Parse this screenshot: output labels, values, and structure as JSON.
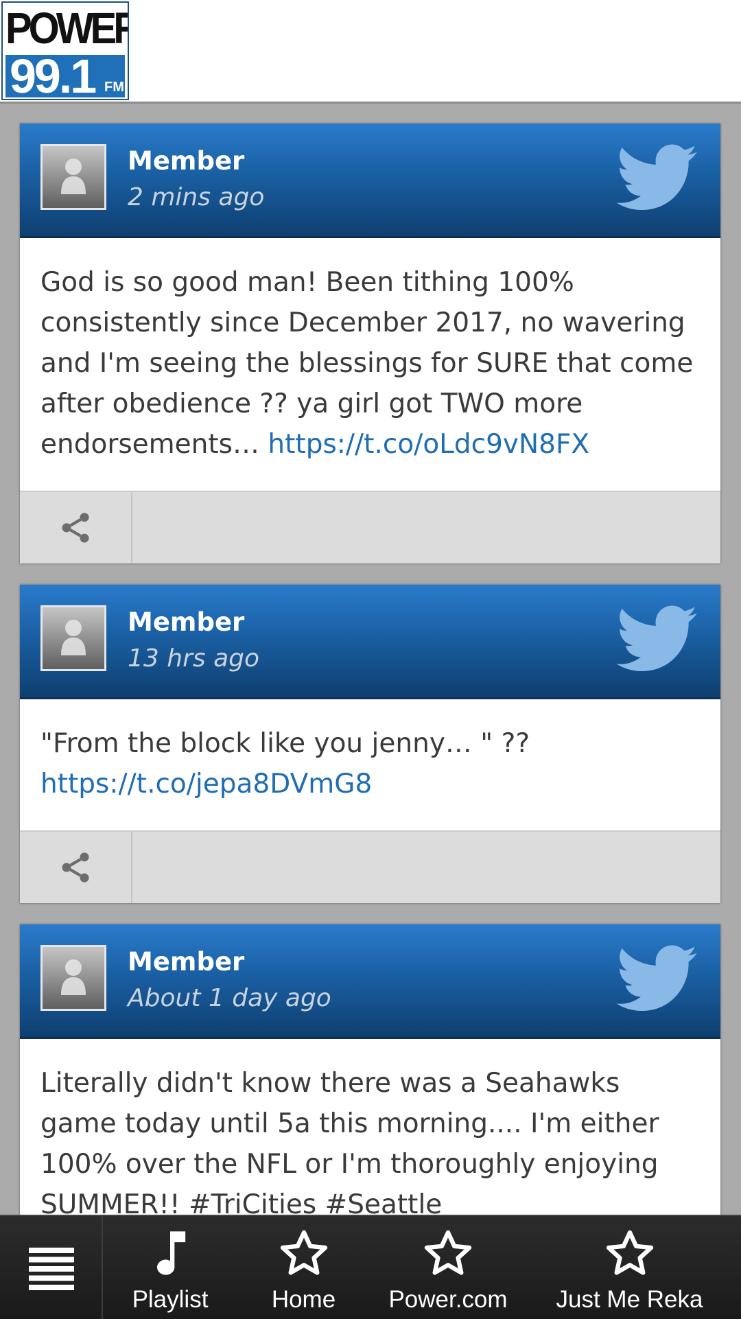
{
  "header": {
    "logo": {
      "word": "POWER",
      "frequency": "99.1",
      "band": "FM",
      "colors": {
        "blue": "#1f70b8",
        "black": "#111111"
      }
    }
  },
  "feed": [
    {
      "author": "Member",
      "time": "2 mins ago",
      "source_icon": "twitter-icon",
      "text": "God is so good man! Been tithing 100% consistently since December 2017, no wavering and I'm seeing the blessings for SURE that come after obedience ?? ya girl got TWO more endorsements… ",
      "link": "https://t.co/oLdc9vN8FX",
      "action_icon": "share-icon"
    },
    {
      "author": "Member",
      "time": "13 hrs ago",
      "source_icon": "twitter-icon",
      "text": "\"From the block like you jenny… \" ?? ",
      "link": "https://t.co/jepa8DVmG8",
      "action_icon": "share-icon"
    },
    {
      "author": "Member",
      "time": "About 1 day ago",
      "source_icon": "twitter-icon",
      "text": "Literally didn't know there was a Seahawks game today until 5a this morning.... I'm either 100% over the NFL or I'm thoroughly enjoying SUMMER!! #TriCities #Seattle",
      "link": "",
      "action_icon": "share-icon"
    }
  ],
  "bottom_nav": {
    "menu_icon": "menu-icon",
    "items": [
      {
        "label": "Playlist",
        "icon": "music-note-icon"
      },
      {
        "label": "Home",
        "icon": "star-icon"
      },
      {
        "label": "Power.com",
        "icon": "star-icon"
      },
      {
        "label": "Just Me Reka",
        "icon": "star-icon"
      }
    ]
  },
  "colors": {
    "card_header_top": "#2a7bcb",
    "card_header_bottom": "#0e3f70",
    "link": "#1f6db3",
    "page_background": "#ababab",
    "nav_background": "#1f1f1f"
  }
}
